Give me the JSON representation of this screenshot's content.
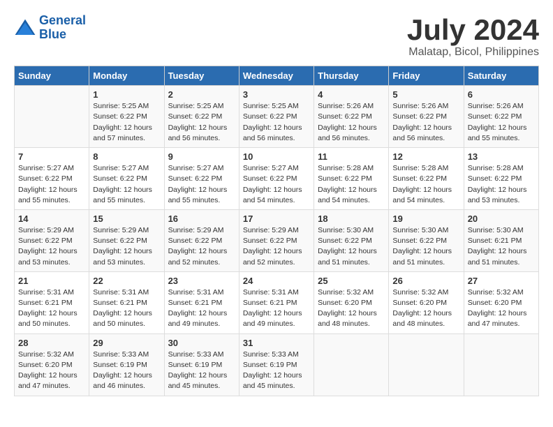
{
  "header": {
    "logo_line1": "General",
    "logo_line2": "Blue",
    "month_year": "July 2024",
    "location": "Malatap, Bicol, Philippines"
  },
  "columns": [
    "Sunday",
    "Monday",
    "Tuesday",
    "Wednesday",
    "Thursday",
    "Friday",
    "Saturday"
  ],
  "weeks": [
    [
      {
        "day": "",
        "info": ""
      },
      {
        "day": "1",
        "info": "Sunrise: 5:25 AM\nSunset: 6:22 PM\nDaylight: 12 hours\nand 57 minutes."
      },
      {
        "day": "2",
        "info": "Sunrise: 5:25 AM\nSunset: 6:22 PM\nDaylight: 12 hours\nand 56 minutes."
      },
      {
        "day": "3",
        "info": "Sunrise: 5:25 AM\nSunset: 6:22 PM\nDaylight: 12 hours\nand 56 minutes."
      },
      {
        "day": "4",
        "info": "Sunrise: 5:26 AM\nSunset: 6:22 PM\nDaylight: 12 hours\nand 56 minutes."
      },
      {
        "day": "5",
        "info": "Sunrise: 5:26 AM\nSunset: 6:22 PM\nDaylight: 12 hours\nand 56 minutes."
      },
      {
        "day": "6",
        "info": "Sunrise: 5:26 AM\nSunset: 6:22 PM\nDaylight: 12 hours\nand 55 minutes."
      }
    ],
    [
      {
        "day": "7",
        "info": "Sunrise: 5:27 AM\nSunset: 6:22 PM\nDaylight: 12 hours\nand 55 minutes."
      },
      {
        "day": "8",
        "info": "Sunrise: 5:27 AM\nSunset: 6:22 PM\nDaylight: 12 hours\nand 55 minutes."
      },
      {
        "day": "9",
        "info": "Sunrise: 5:27 AM\nSunset: 6:22 PM\nDaylight: 12 hours\nand 55 minutes."
      },
      {
        "day": "10",
        "info": "Sunrise: 5:27 AM\nSunset: 6:22 PM\nDaylight: 12 hours\nand 54 minutes."
      },
      {
        "day": "11",
        "info": "Sunrise: 5:28 AM\nSunset: 6:22 PM\nDaylight: 12 hours\nand 54 minutes."
      },
      {
        "day": "12",
        "info": "Sunrise: 5:28 AM\nSunset: 6:22 PM\nDaylight: 12 hours\nand 54 minutes."
      },
      {
        "day": "13",
        "info": "Sunrise: 5:28 AM\nSunset: 6:22 PM\nDaylight: 12 hours\nand 53 minutes."
      }
    ],
    [
      {
        "day": "14",
        "info": "Sunrise: 5:29 AM\nSunset: 6:22 PM\nDaylight: 12 hours\nand 53 minutes."
      },
      {
        "day": "15",
        "info": "Sunrise: 5:29 AM\nSunset: 6:22 PM\nDaylight: 12 hours\nand 53 minutes."
      },
      {
        "day": "16",
        "info": "Sunrise: 5:29 AM\nSunset: 6:22 PM\nDaylight: 12 hours\nand 52 minutes."
      },
      {
        "day": "17",
        "info": "Sunrise: 5:29 AM\nSunset: 6:22 PM\nDaylight: 12 hours\nand 52 minutes."
      },
      {
        "day": "18",
        "info": "Sunrise: 5:30 AM\nSunset: 6:22 PM\nDaylight: 12 hours\nand 51 minutes."
      },
      {
        "day": "19",
        "info": "Sunrise: 5:30 AM\nSunset: 6:22 PM\nDaylight: 12 hours\nand 51 minutes."
      },
      {
        "day": "20",
        "info": "Sunrise: 5:30 AM\nSunset: 6:21 PM\nDaylight: 12 hours\nand 51 minutes."
      }
    ],
    [
      {
        "day": "21",
        "info": "Sunrise: 5:31 AM\nSunset: 6:21 PM\nDaylight: 12 hours\nand 50 minutes."
      },
      {
        "day": "22",
        "info": "Sunrise: 5:31 AM\nSunset: 6:21 PM\nDaylight: 12 hours\nand 50 minutes."
      },
      {
        "day": "23",
        "info": "Sunrise: 5:31 AM\nSunset: 6:21 PM\nDaylight: 12 hours\nand 49 minutes."
      },
      {
        "day": "24",
        "info": "Sunrise: 5:31 AM\nSunset: 6:21 PM\nDaylight: 12 hours\nand 49 minutes."
      },
      {
        "day": "25",
        "info": "Sunrise: 5:32 AM\nSunset: 6:20 PM\nDaylight: 12 hours\nand 48 minutes."
      },
      {
        "day": "26",
        "info": "Sunrise: 5:32 AM\nSunset: 6:20 PM\nDaylight: 12 hours\nand 48 minutes."
      },
      {
        "day": "27",
        "info": "Sunrise: 5:32 AM\nSunset: 6:20 PM\nDaylight: 12 hours\nand 47 minutes."
      }
    ],
    [
      {
        "day": "28",
        "info": "Sunrise: 5:32 AM\nSunset: 6:20 PM\nDaylight: 12 hours\nand 47 minutes."
      },
      {
        "day": "29",
        "info": "Sunrise: 5:33 AM\nSunset: 6:19 PM\nDaylight: 12 hours\nand 46 minutes."
      },
      {
        "day": "30",
        "info": "Sunrise: 5:33 AM\nSunset: 6:19 PM\nDaylight: 12 hours\nand 45 minutes."
      },
      {
        "day": "31",
        "info": "Sunrise: 5:33 AM\nSunset: 6:19 PM\nDaylight: 12 hours\nand 45 minutes."
      },
      {
        "day": "",
        "info": ""
      },
      {
        "day": "",
        "info": ""
      },
      {
        "day": "",
        "info": ""
      }
    ]
  ]
}
